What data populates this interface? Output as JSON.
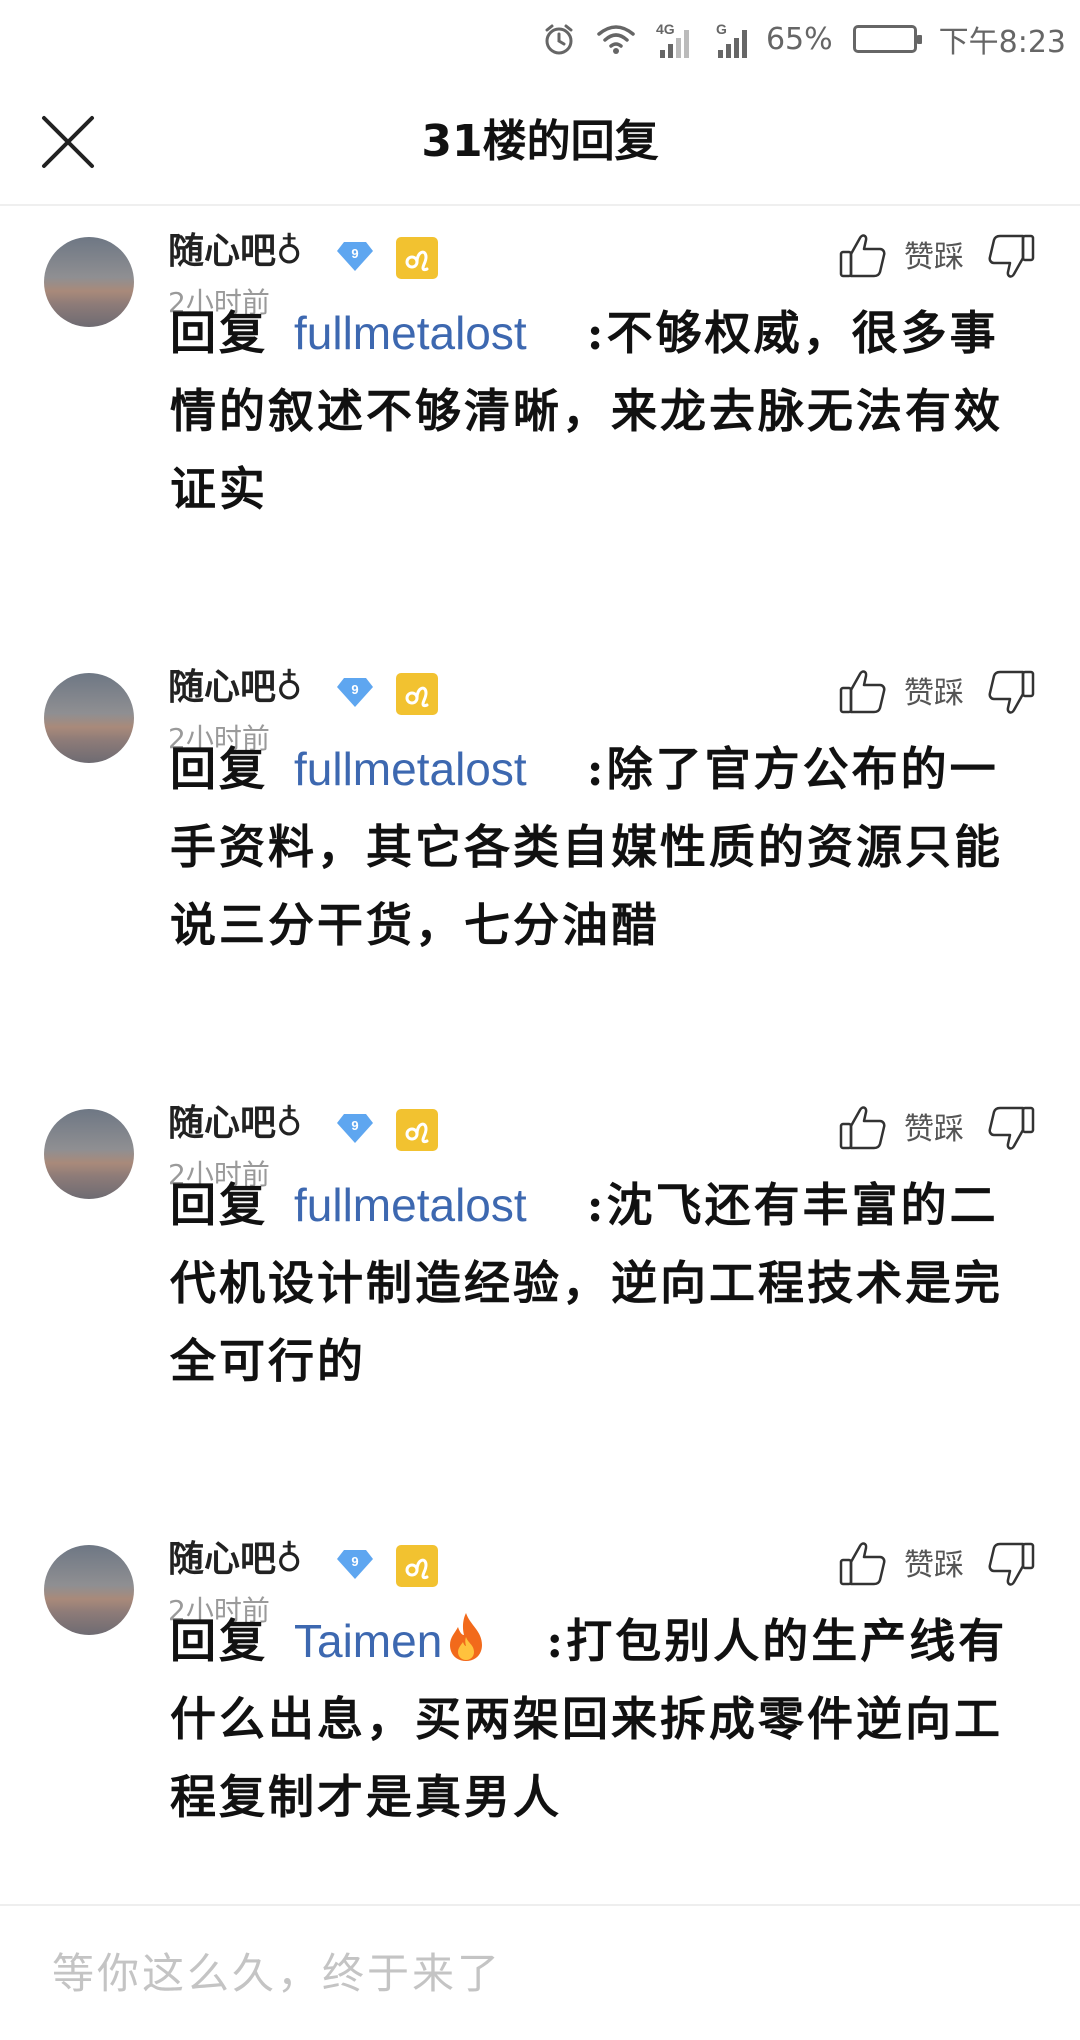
{
  "status_bar": {
    "network_label": "4G",
    "signal2_label": "G",
    "battery_percent": "65%",
    "battery_level": 0.65,
    "time": "下午8:23",
    "icons": [
      "alarm-icon",
      "wifi-icon",
      "signal-4g-icon",
      "signal-g-icon",
      "battery-icon"
    ]
  },
  "header": {
    "title": "31楼的回复",
    "close_icon": "close-icon"
  },
  "replies": [
    {
      "username": "随心吧♁",
      "level": "9",
      "time": "2小时前",
      "vote_label": "赞踩",
      "prefix": "回复",
      "target": "fullmetalost",
      "text": ":不够权威，很多事情的叙述不够清晰，来龙去脉无法有效证实"
    },
    {
      "username": "随心吧♁",
      "level": "9",
      "time": "2小时前",
      "vote_label": "赞踩",
      "prefix": "回复",
      "target": "fullmetalost",
      "text": ":除了官方公布的一手资料，其它各类自媒性质的资源只能说三分干货，七分油醋"
    },
    {
      "username": "随心吧♁",
      "level": "9",
      "time": "2小时前",
      "vote_label": "赞踩",
      "prefix": "回复",
      "target": "fullmetalost",
      "text": ":沈飞还有丰富的二代机设计制造经验，逆向工程技术是完全可行的"
    },
    {
      "username": "随心吧♁",
      "level": "9",
      "time": "2小时前",
      "vote_label": "赞踩",
      "prefix": "回复",
      "target": "Taimen",
      "text": ":打包别人的生产线有什么出息，买两架回来拆成零件逆向工程复制才是真男人"
    }
  ],
  "input": {
    "placeholder": "等你这么久，终于来了"
  },
  "colors": {
    "link": "#3d68b0",
    "level_badge": "#5ea6f0",
    "zodiac_badge": "#f2c230"
  }
}
